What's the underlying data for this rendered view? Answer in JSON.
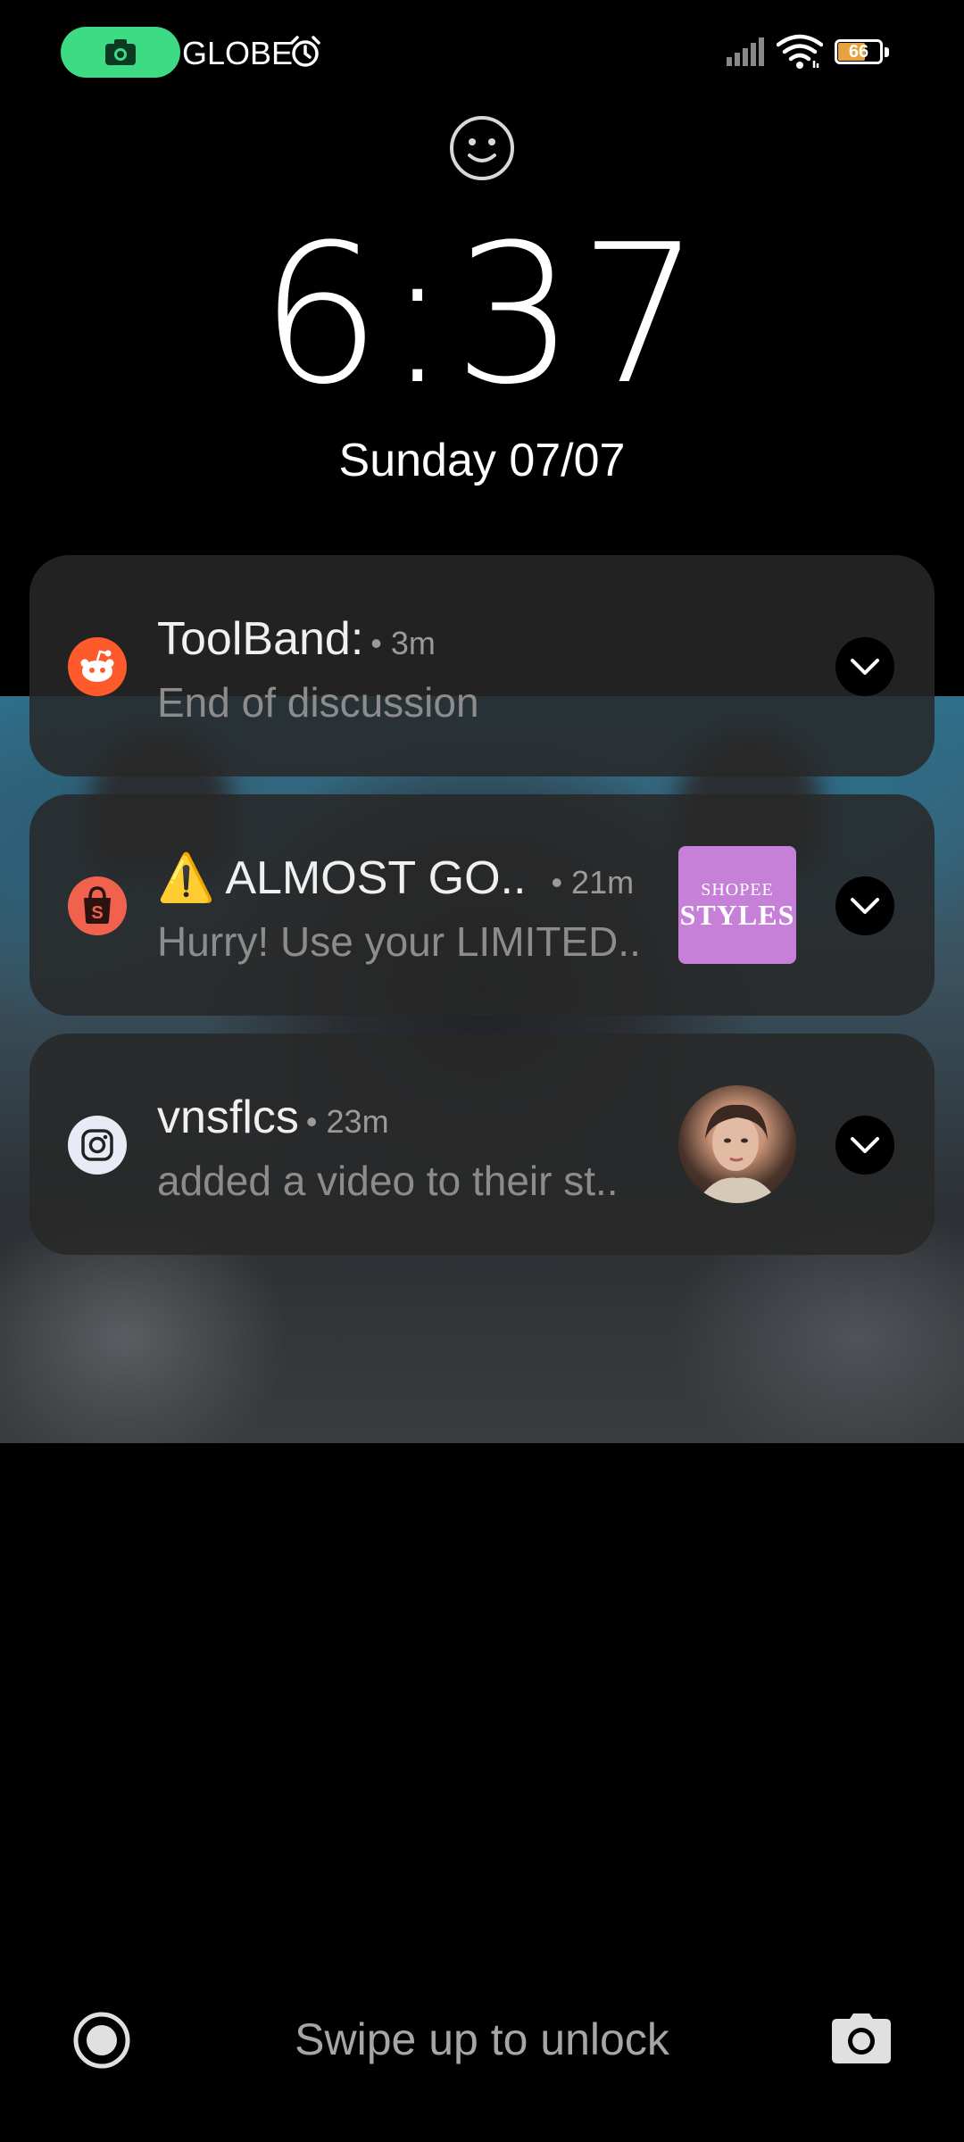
{
  "status_bar": {
    "carrier": "GLOBE",
    "battery_level": "66",
    "battery_fraction": 0.66,
    "battery_color": "#e6a23c",
    "recording_pill_color": "#3ddc84",
    "icons": [
      "camera-icon",
      "alarm-icon",
      "signal-icon",
      "wifi-icon",
      "battery-icon"
    ]
  },
  "lock": {
    "time": "6:37",
    "date": "Sunday 07/07",
    "face_icon": "face-unlock-icon"
  },
  "notifications": [
    {
      "app_icon": "reddit-icon",
      "icon_color": "#ff5a2c",
      "title": "ToolBand:",
      "time": "• 3m",
      "body": "End of discussion"
    },
    {
      "app_icon": "shopee-icon",
      "icon_color": "#f0624d",
      "title": "⚠️ ALMOST GO..",
      "time": "• 21m",
      "body": "Hurry! Use your LIMITED..",
      "thumbnail": {
        "line1": "SHOPEE",
        "line2": "STYLES",
        "color": "#c780d8"
      }
    },
    {
      "app_icon": "instagram-icon",
      "icon_color": "#e8ebf5",
      "title": "vnsflcs",
      "time": "• 23m",
      "body": "added a video to their st..",
      "thumbnail": "profile-photo"
    }
  ],
  "bottom": {
    "swipe_text": "Swipe up to unlock",
    "left_icon": "assistant-icon",
    "right_icon": "camera-icon"
  }
}
